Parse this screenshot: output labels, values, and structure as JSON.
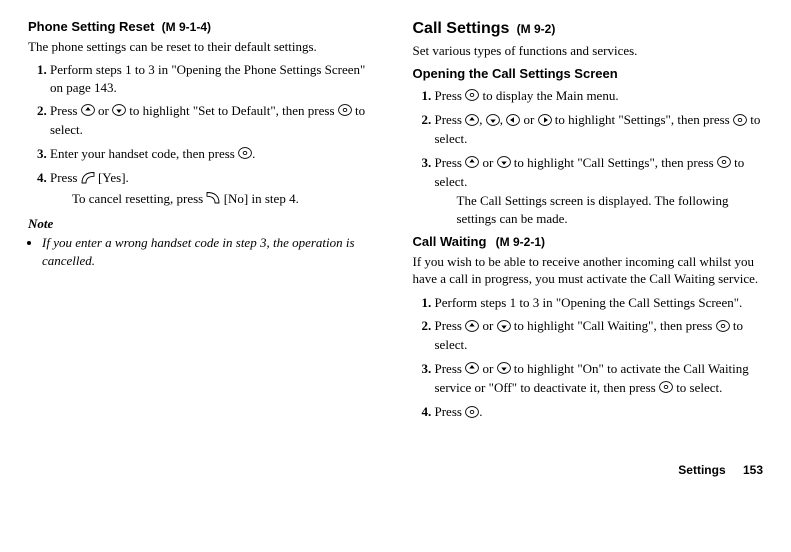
{
  "left": {
    "heading": "Phone Setting Reset",
    "code": "(M 9-1-4)",
    "intro": "The phone settings can be reset to their default settings.",
    "steps": [
      "Perform steps 1 to 3 in \"Opening the Phone Settings Screen\" on page 143.",
      "Press {up} or {down} to highlight \"Set to Default\", then press {centre} to select.",
      "Enter your handset code, then press {centre}.",
      "Press {softleft} [Yes]."
    ],
    "substep": "To cancel resetting, press {softright} [No] in step 4.",
    "note_title": "Note",
    "note_item": "If you enter a wrong handset code in step 3, the operation is cancelled."
  },
  "right": {
    "heading": "Call Settings",
    "code": "(M 9-2)",
    "intro": "Set various types of functions and services.",
    "opening_heading": "Opening the Call Settings Screen",
    "opening_steps": [
      "Press {centre} to display the Main menu.",
      "Press {up}, {down}, {left} or {right} to highlight \"Settings\", then press {centre} to select.",
      "Press {up} or {down} to highlight \"Call Settings\", then press {centre} to select."
    ],
    "opening_after": "The Call Settings screen is displayed. The following settings can be made.",
    "cw_heading": "Call Waiting",
    "cw_code": "(M 9-2-1)",
    "cw_intro": "If you wish to be able to receive another incoming call whilst you have a call in progress, you must activate the Call Waiting service.",
    "cw_steps": [
      "Perform steps 1 to 3 in \"Opening the Call Settings Screen\".",
      "Press {up} or {down} to highlight \"Call Waiting\", then press {centre} to select.",
      "Press {up} or {down} to highlight \"On\" to activate the Call Waiting service or \"Off\" to deactivate it, then press {centre} to select.",
      "Press {centre}."
    ]
  },
  "footer": {
    "label": "Settings",
    "page": "153"
  }
}
